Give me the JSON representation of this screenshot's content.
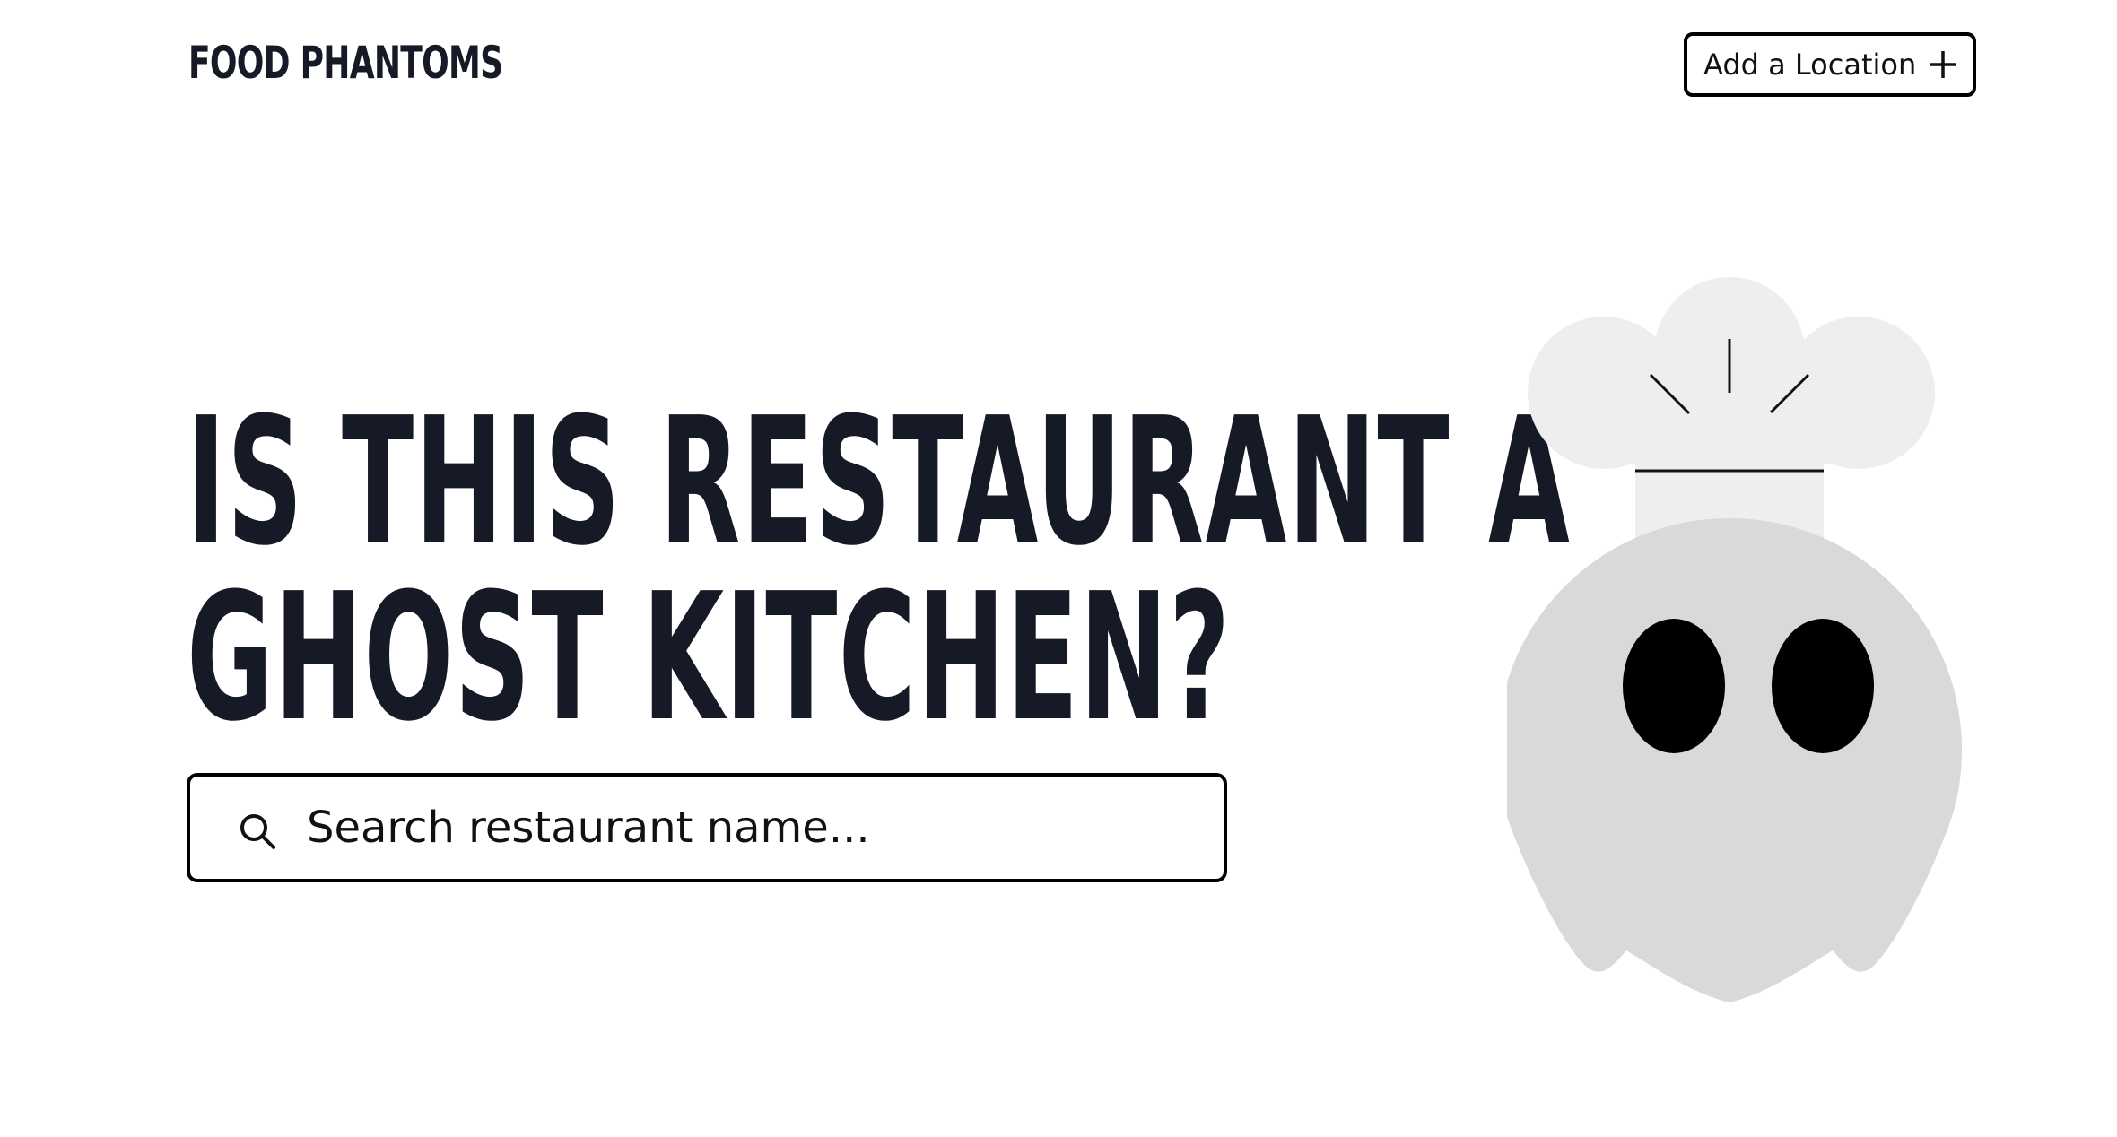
{
  "header": {
    "brand": "FOOD PHANTOMS",
    "add_location_label": "Add a Location",
    "add_location_icon": "plus-icon"
  },
  "hero": {
    "headline_line1": "IS THIS RESTAURANT A",
    "headline_line2": "GHOST KITCHEN?",
    "search": {
      "placeholder": "Search restaurant name...",
      "value": "",
      "icon": "search-icon"
    },
    "illustration": "ghost-chef-illustration"
  },
  "colors": {
    "text": "#151a26",
    "border": "#000000",
    "ghost_body": "#d9d9d9",
    "ghost_hat": "#eeeeee",
    "ghost_eyes": "#000000",
    "background": "#ffffff"
  }
}
